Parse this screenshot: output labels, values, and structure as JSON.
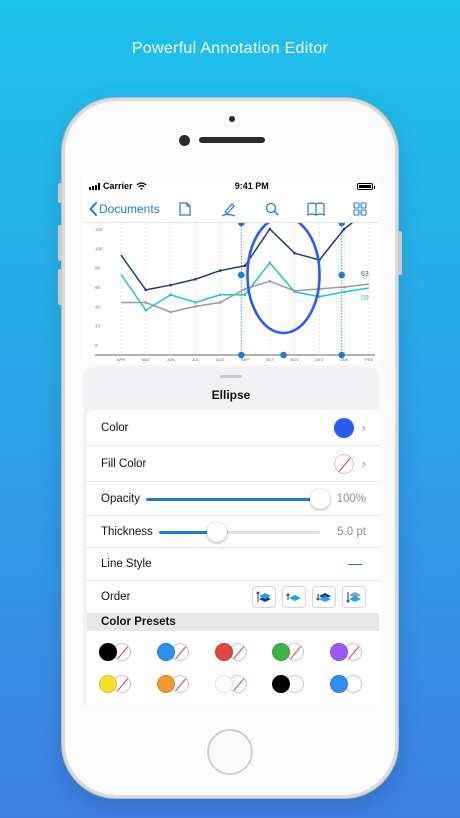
{
  "headline": "Powerful Annotation Editor",
  "status": {
    "carrier": "Carrier",
    "time": "9:41 PM"
  },
  "nav": {
    "back_label": "Documents",
    "icons": [
      "document-icon",
      "pen-icon",
      "search-icon",
      "book-icon",
      "grid-icon"
    ],
    "accent": "#1f7ad6"
  },
  "chart_data": {
    "type": "line",
    "y_ticks": [
      "120",
      "100",
      "80",
      "60",
      "40",
      "20",
      "0"
    ],
    "x_ticks": [
      "APR",
      "MAY",
      "JUN",
      "JUL",
      "AUG",
      "SEP",
      "OCT",
      "NOV",
      "DEC",
      "JAN",
      "FEB"
    ],
    "ylim": [
      0,
      120
    ],
    "series": [
      {
        "color": "#1c3a7a",
        "values": [
          93,
          57,
          62,
          68,
          77,
          82,
          120,
          95,
          88,
          120,
          140
        ]
      },
      {
        "color": "#21c3d8",
        "values": [
          73,
          36,
          52,
          44,
          52,
          52,
          85,
          55,
          50,
          55,
          59
        ]
      },
      {
        "color": "#9a9a9a",
        "values": [
          44,
          44,
          34,
          40,
          44,
          58,
          66,
          56,
          58,
          60,
          63
        ]
      }
    ],
    "end_labels": [
      "63",
      "59"
    ],
    "annotation": {
      "type": "ellipse",
      "color": "#2a5bf2"
    }
  },
  "sheet": {
    "title": "Ellipse",
    "color_label": "Color",
    "color_value": "#2a5bf2",
    "fill_label": "Fill Color",
    "opacity_label": "Opacity",
    "opacity_value": "100%",
    "opacity_fraction": 1.0,
    "thickness_label": "Thickness",
    "thickness_value": "5.0 pt",
    "thickness_fraction": 0.36,
    "line_style_label": "Line Style",
    "order_label": "Order",
    "order_buttons": [
      "bring-to-front-icon",
      "bring-forward-icon",
      "send-backward-icon",
      "send-to-back-icon"
    ],
    "presets_label": "Color Presets",
    "presets": [
      [
        "#000000",
        "#2b8ef0",
        "#e04848",
        "#3cb44a",
        "#9a5cf0"
      ],
      [
        "#f5e12a",
        "#f29a2e",
        "#ffffff",
        "#000000",
        "#2b8ef0"
      ]
    ]
  }
}
